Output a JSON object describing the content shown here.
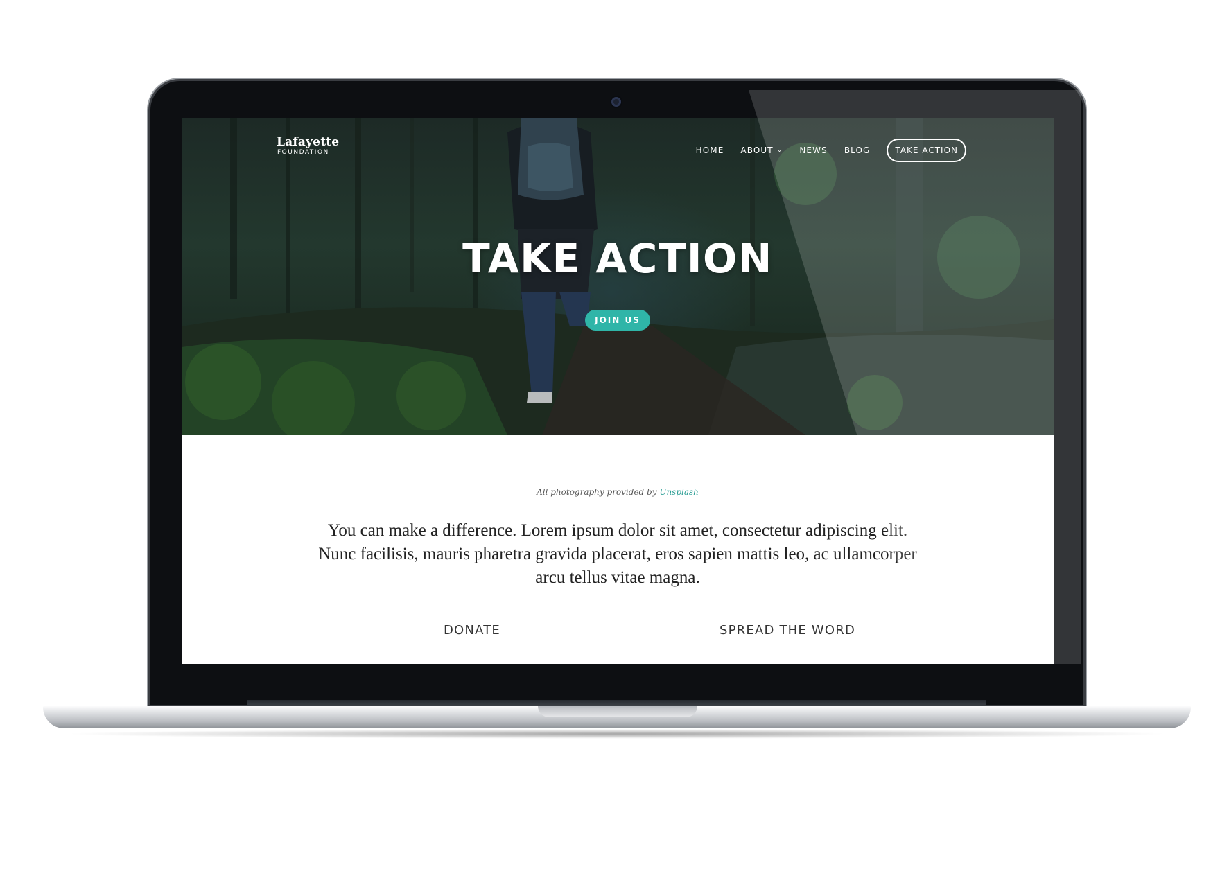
{
  "site": {
    "logo_main": "Lafayette",
    "logo_sub": "FOUNDATION"
  },
  "nav": {
    "items": [
      {
        "label": "HOME"
      },
      {
        "label": "ABOUT",
        "dropdown": true
      },
      {
        "label": "NEWS"
      },
      {
        "label": "BLOG"
      }
    ],
    "cta_label": "TAKE ACTION"
  },
  "hero": {
    "title": "TAKE ACTION",
    "button_label": "JOIN US"
  },
  "content": {
    "credit_prefix": "All photography provided by ",
    "credit_link": "Unsplash",
    "lead": "You can make a difference. Lorem ipsum dolor sit amet, consectetur adipiscing elit. Nunc facilisis, mauris pharetra gravida placerat, eros sapien mattis leo, ac ullamcorper arcu tellus vitae magna.",
    "columns": [
      {
        "heading": "DONATE"
      },
      {
        "heading": "SPREAD THE WORD"
      }
    ]
  },
  "colors": {
    "accent": "#2fb5a8",
    "link": "#2a9d94",
    "bezel": "#0d0f12"
  },
  "icons": {
    "dropdown": "chevron-down-icon"
  }
}
